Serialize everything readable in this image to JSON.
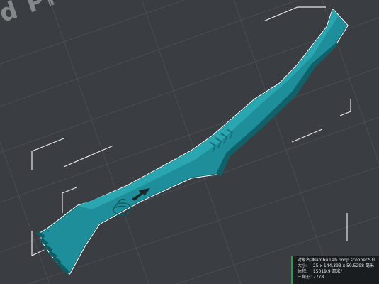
{
  "viewport": {
    "plate_text": "d PI",
    "model_color": "#1e8f9a"
  },
  "object_info": {
    "rows": [
      {
        "label": "对象名字:",
        "value": "Bambu Lab poop scooper.STL"
      },
      {
        "label": "大小:",
        "value": "25 x 144.393 x 59.5298 毫米"
      },
      {
        "label": "体积:",
        "value": "15019.9 毫米³"
      },
      {
        "label": "三角形:",
        "value": "7778"
      }
    ],
    "accent_color": "#1fa13e"
  }
}
